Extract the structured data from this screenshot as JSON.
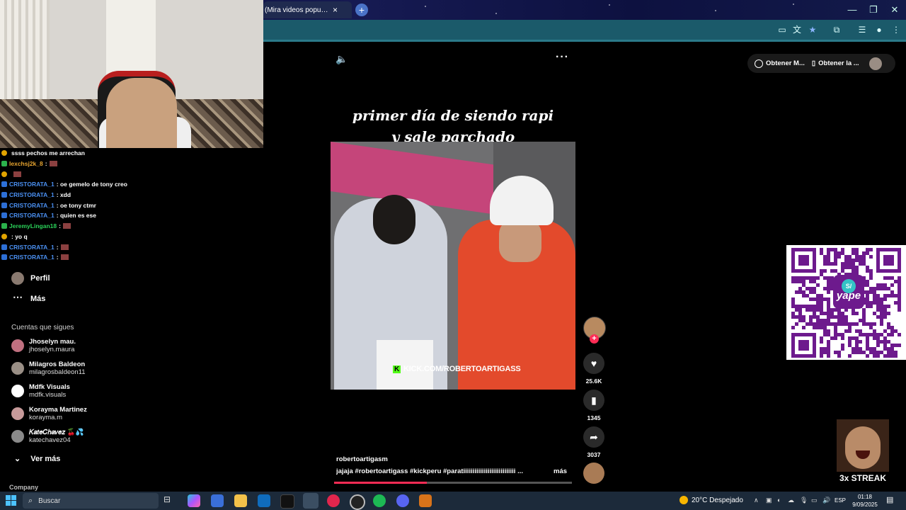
{
  "browser": {
    "tab_title": "(Mira videos populares sc",
    "tab_close": "×",
    "new_tab": "+",
    "window_controls": [
      "—",
      "❐",
      "✕"
    ]
  },
  "stream": {
    "chat": [
      {
        "user": "",
        "text": "ssss pechos me arrechan",
        "user_color": "#e04040",
        "badge": "y"
      },
      {
        "user": "lexchsj2k_8",
        "text": ":",
        "user_color": "#e8a530",
        "badge": "g",
        "emote": true
      },
      {
        "user": "",
        "text": "",
        "user_color": "#e04040",
        "badge": "y",
        "emote": true
      },
      {
        "user": "CRISTORATA_1",
        "text": ": oe gemelo de tony creo",
        "user_color": "#4a8ff0",
        "badge": "b"
      },
      {
        "user": "CRISTORATA_1",
        "text": ": xdd",
        "user_color": "#4a8ff0",
        "badge": "b"
      },
      {
        "user": "CRISTORATA_1",
        "text": ": oe tony ctmr",
        "user_color": "#4a8ff0",
        "badge": "b"
      },
      {
        "user": "CRISTORATA_1",
        "text": ": quien es ese",
        "user_color": "#4a8ff0",
        "badge": "b"
      },
      {
        "user": "JeremyLingan18",
        "text": ":",
        "user_color": "#2bd35a",
        "badge": "g",
        "emote": true
      },
      {
        "user": "",
        "text": ": yo q",
        "user_color": "#e04040",
        "badge": "y"
      },
      {
        "user": "CRISTORATA_1",
        "text": ":",
        "user_color": "#4a8ff0",
        "badge": "b",
        "emote": true
      },
      {
        "user": "CRISTORATA_1",
        "text": ":",
        "user_color": "#4a8ff0",
        "badge": "b",
        "emote": true
      }
    ],
    "streak_label": "3x STREAK"
  },
  "tiktok_nav": {
    "items": [
      {
        "label": "Perfil",
        "icon": "profile-avatar-icon"
      },
      {
        "label": "Más",
        "icon": "more-dots-icon"
      }
    ],
    "following_heading": "Cuentas que sigues",
    "accounts": [
      {
        "name": "Jhoselyn mau.⁣",
        "handle": "jhoselyn.maura",
        "color": "#c07080"
      },
      {
        "name": "Milagros Baldeon",
        "handle": "milagrosbaldeon11",
        "color": "#9a8f86"
      },
      {
        "name": "Mdfk Visuals",
        "handle": "mdfk.visuals",
        "color": "#ffffff"
      },
      {
        "name": "Korayma Martinez",
        "handle": "korayma.m",
        "color": "#c79a9a"
      },
      {
        "name": "𝐾𝑎𝑡𝑒𝐶ℎ𝑎𝑣𝑒𝑧 🍒💦",
        "handle": "katechavez04",
        "color": "#8a8a8a"
      }
    ],
    "see_more": "Ver más",
    "company": "Company"
  },
  "video": {
    "caption_line1": "primer día de siendo rapi",
    "caption_line2": "y sale parchado",
    "watermark": "KICK.COM/ROBERTOARTIGASS",
    "author": "robertoartigasm",
    "description": "jajaja #robertoartigass #kickperu #paratiiiiiiiiiiiiiiiiiiiiiiiiiiii ...",
    "more_link": "más",
    "progress": 0.39,
    "likes": "25.6K",
    "saves": "1345",
    "shares": "3037",
    "more_dots": "···"
  },
  "top_right": {
    "chip1": "Obtener M...",
    "chip2": "Obtener la ..."
  },
  "qr": {
    "badge_text": "yape",
    "badge_symbol": "S/"
  },
  "taskbar": {
    "search_placeholder": "Buscar",
    "weather": "20°C  Despejado",
    "lang": "ESP",
    "time": "01:18",
    "date": "9/09/2025"
  },
  "colors": {
    "tiktok_red": "#fe2c55",
    "toolbar_teal": "#1b5a6a",
    "yape_purple": "#6d1a8d"
  }
}
